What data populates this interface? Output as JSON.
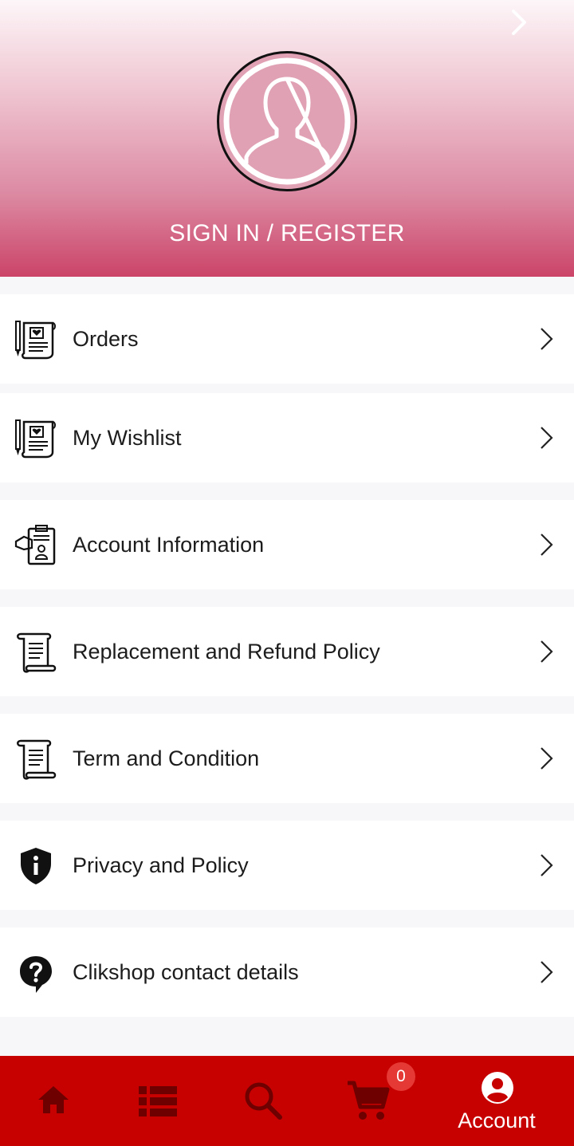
{
  "header": {
    "signin_label": "SIGN IN / REGISTER",
    "gradient_top": "#fdf6f8",
    "gradient_bottom": "#cb4468"
  },
  "menu": {
    "items": [
      {
        "label": "Orders",
        "icon": "order-list-icon"
      },
      {
        "label": "My Wishlist",
        "icon": "wishlist-icon"
      },
      {
        "label": "Account Information",
        "icon": "account-info-icon"
      },
      {
        "label": "Replacement and Refund Policy",
        "icon": "scroll-document-icon"
      },
      {
        "label": "Term and Condition",
        "icon": "scroll-document-icon"
      },
      {
        "label": "Privacy and Policy",
        "icon": "shield-info-icon"
      },
      {
        "label": "Clikshop contact details",
        "icon": "help-bubble-icon"
      }
    ]
  },
  "bottom_nav": {
    "background": "#c70000",
    "active_color": "#ffffff",
    "inactive_color": "#6e0000",
    "items": [
      {
        "icon": "home-icon"
      },
      {
        "icon": "list-icon"
      },
      {
        "icon": "search-icon"
      },
      {
        "icon": "cart-icon",
        "badge": "0"
      },
      {
        "icon": "account-icon",
        "label": "Account"
      }
    ]
  }
}
